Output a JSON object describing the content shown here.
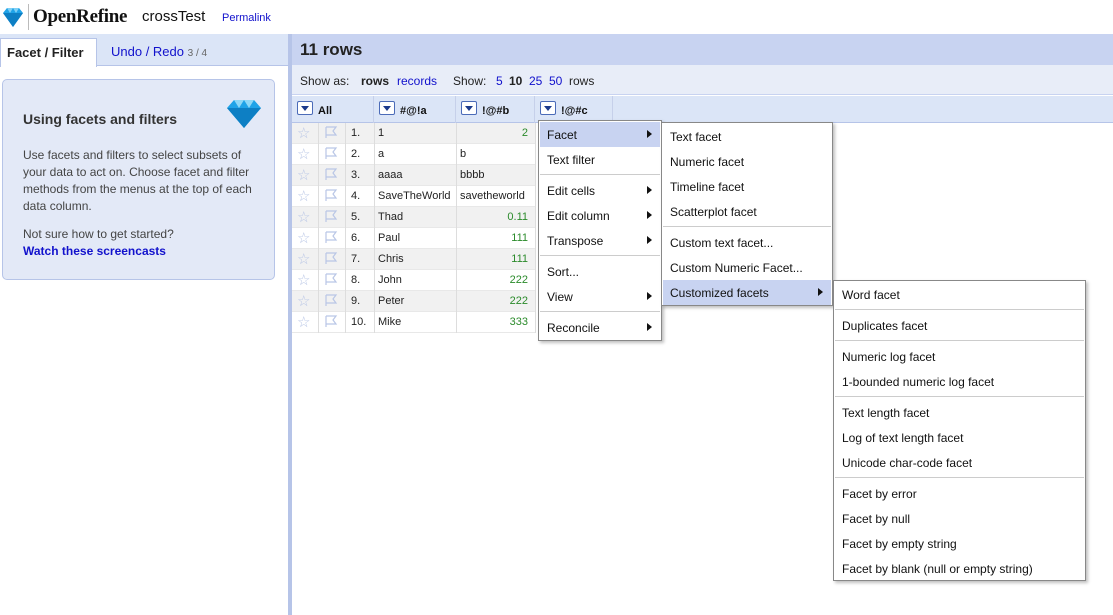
{
  "header": {
    "brand": "OpenRefine",
    "project": "crossTest",
    "permalink": "Permalink"
  },
  "left": {
    "tab_facet": "Facet / Filter",
    "tab_undo": "Undo / Redo",
    "tab_undo_count": "3 / 4",
    "help_title": "Using facets and filters",
    "help_body": "Use facets and filters to select subsets of your data to act on. Choose facet and filter methods from the menus at the top of each data column.",
    "help_question": "Not sure how to get started?",
    "help_link": "Watch these screencasts"
  },
  "main": {
    "row_count": "11 rows",
    "show_as_label": "Show as:",
    "show_as_rows": "rows",
    "show_as_records": "records",
    "show_label": "Show:",
    "page_sizes": [
      "5",
      "10",
      "25",
      "50"
    ],
    "rows_suffix": "rows",
    "columns": [
      "All",
      "#@!a",
      "!@#b",
      "!@#c"
    ],
    "rows": [
      {
        "n": "1.",
        "a": "1",
        "b": "2",
        "b_numeric": true
      },
      {
        "n": "2.",
        "a": "a",
        "b": "b",
        "b_numeric": false
      },
      {
        "n": "3.",
        "a": "aaaa",
        "b": "bbbb",
        "b_numeric": false
      },
      {
        "n": "4.",
        "a": "SaveTheWorld",
        "b": "savetheworld",
        "b_numeric": false
      },
      {
        "n": "5.",
        "a": "Thad",
        "b": "0.11",
        "b_numeric": true
      },
      {
        "n": "6.",
        "a": "Paul",
        "b": "111",
        "b_numeric": true
      },
      {
        "n": "7.",
        "a": "Chris",
        "b": "111",
        "b_numeric": true
      },
      {
        "n": "8.",
        "a": "John",
        "b": "222",
        "b_numeric": true
      },
      {
        "n": "9.",
        "a": "Peter",
        "b": "222",
        "b_numeric": true
      },
      {
        "n": "10.",
        "a": "Mike",
        "b": "333",
        "b_numeric": true
      }
    ]
  },
  "menu1": {
    "items": [
      "Facet",
      "Text filter",
      "Edit cells",
      "Edit column",
      "Transpose",
      "Sort...",
      "View",
      "Reconcile"
    ]
  },
  "menu2": {
    "items": [
      "Text facet",
      "Numeric facet",
      "Timeline facet",
      "Scatterplot facet",
      "Custom text facet...",
      "Custom Numeric Facet...",
      "Customized facets"
    ]
  },
  "menu3": {
    "items": [
      "Word facet",
      "Duplicates facet",
      "Numeric log facet",
      "1-bounded numeric log facet",
      "Text length facet",
      "Log of text length facet",
      "Unicode char-code facet",
      "Facet by error",
      "Facet by null",
      "Facet by empty string",
      "Facet by blank (null or empty string)"
    ]
  },
  "colors": {
    "accent": "#11c",
    "header_bg": "#c8d3f1",
    "number_green": "#2a8a2a"
  }
}
